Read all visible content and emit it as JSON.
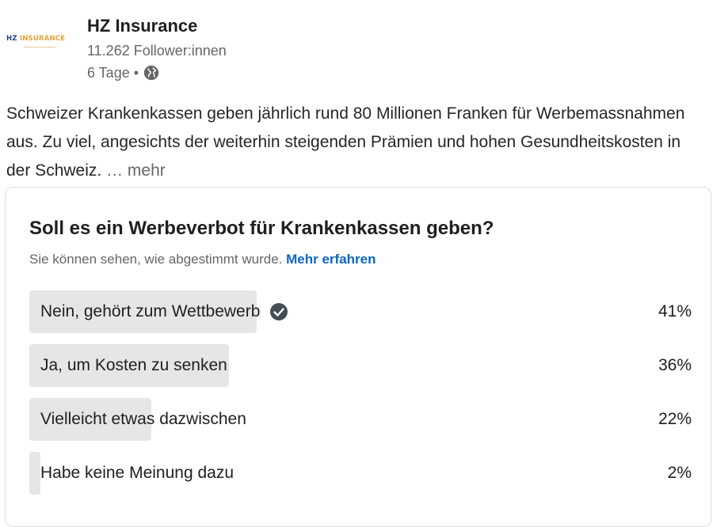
{
  "post": {
    "company": "HZ Insurance",
    "logo": {
      "hz": "HZ",
      "insurance": "INSURANCE"
    },
    "followers": "11.262 Follower:innen",
    "age": "6 Tage",
    "separator": "•",
    "text": "Schweizer Krankenkassen geben jährlich rund 80 Millionen Franken für Werbemassnahmen aus. Zu viel, angesichts der weiterhin steigenden Prämien und hohen Gesundheitskosten in der Schweiz.",
    "more": "… mehr"
  },
  "poll": {
    "question": "Soll es ein Werbeverbot für Krankenkassen geben?",
    "note": "Sie können sehen, wie abgestimmt wurde.",
    "learn_more": "Mehr erfahren",
    "options": [
      {
        "label": "Nein, gehört zum Wettbewerb",
        "percent": "41%",
        "share": 0.41,
        "selected": true
      },
      {
        "label": "Ja, um Kosten zu senken",
        "percent": "36%",
        "share": 0.36,
        "selected": false
      },
      {
        "label": "Vielleicht etwas dazwischen",
        "percent": "22%",
        "share": 0.22,
        "selected": false
      },
      {
        "label": "Habe keine Meinung dazu",
        "percent": "2%",
        "share": 0.02,
        "selected": false
      }
    ]
  },
  "colors": {
    "bar": "#e6e6e6",
    "link": "#0a66c2",
    "check": "#444c56"
  },
  "icons": {
    "visibility": "globe-icon",
    "selected": "checkmark-circle-icon"
  }
}
